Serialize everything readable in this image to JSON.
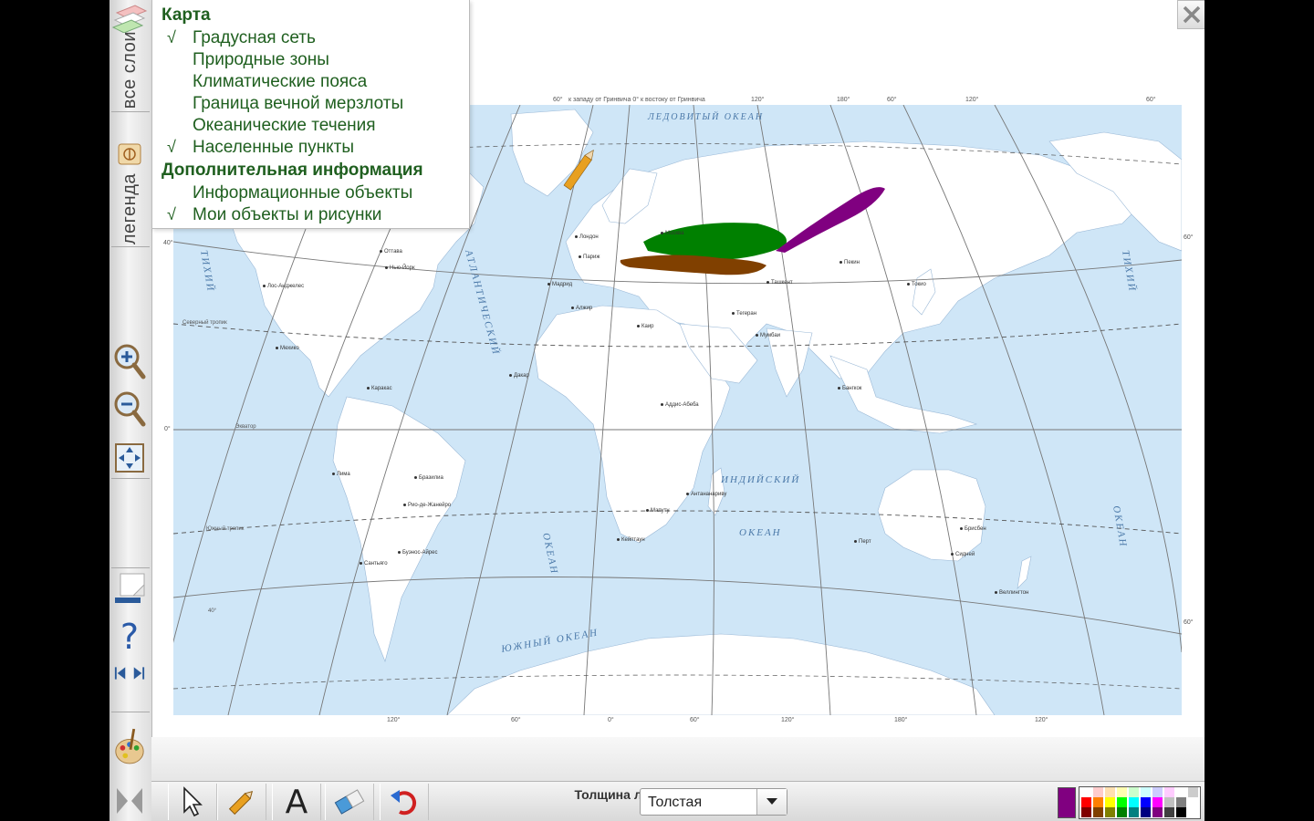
{
  "sidebar": {
    "layers_tab": "все слои",
    "legend_tab": "легенда"
  },
  "layers_panel": {
    "map_title": "Карта",
    "items": [
      {
        "label": "Градусная сеть",
        "checked": true
      },
      {
        "label": "Природные зоны",
        "checked": false
      },
      {
        "label": "Климатические пояса",
        "checked": false
      },
      {
        "label": "Граница вечной мерзлоты",
        "checked": false
      },
      {
        "label": "Океанические течения",
        "checked": false
      },
      {
        "label": "Населенные пункты",
        "checked": true
      }
    ],
    "extra_title": "Дополнительная информация",
    "extra_items": [
      {
        "label": "Информационные объекты",
        "checked": false
      },
      {
        "label": "Мои объекты и рисунки",
        "checked": true
      }
    ],
    "check_mark": "√"
  },
  "map": {
    "oceans": {
      "arctic": "ЛЕДОВИТЫЙ ОКЕАН",
      "atlantic": "АТЛАНТИЧЕСКИЙ",
      "atlantic2": "ОКЕАН",
      "indian": "ИНДИЙСКИЙ",
      "indian2": "ОКЕАН",
      "pacific_left": "ТИХИЙ",
      "pacific_right": "ТИХИЙ",
      "pacific_right2": "ОКЕАН",
      "southern": "ЮЖНЫЙ ОКЕАН"
    },
    "top_coords": [
      "60°",
      "к западу от Гринвича 0° к востоку от Гринвича",
      "120°",
      "180°",
      "60°",
      "120°",
      "60°"
    ],
    "bottom_coords": [
      "120°",
      "60°",
      "0°",
      "60°",
      "120°",
      "180°",
      "120°"
    ],
    "side_coords": [
      "40°",
      "0°",
      "60°",
      "60°"
    ],
    "line_labels": [
      "Северный тропик",
      "Экватор",
      "Южный тропик",
      "40°"
    ],
    "cities": [
      "Оттава",
      "Нью-Йорк",
      "Лос-Анджелес",
      "Мехико",
      "Каракас",
      "Лима",
      "Бразилиа",
      "Рио-де-Жанейро",
      "Сантьяго",
      "Буэнос-Айрес",
      "Дакар",
      "Лондон",
      "Париж",
      "Мадрид",
      "Алжир",
      "Каир",
      "Аддис-Абеба",
      "Кейптаун",
      "Мапуту",
      "Антананариву",
      "Тегеран",
      "Ташкент",
      "Мумбаи",
      "Пекин",
      "Токио",
      "Бангкок",
      "Брисбен",
      "Сидней",
      "Перт",
      "Веллингтон",
      "Москва"
    ],
    "drawing_colors": [
      "#008000",
      "#804000",
      "#800080"
    ]
  },
  "toolbar": {
    "thickness_label": "Толщина линии",
    "thickness_value": "Толстая",
    "text_tool_glyph": "A",
    "help_glyph": "?",
    "current_color": "#800080",
    "palette": [
      [
        "#ffffff",
        "#ffcccc",
        "#ffe0b0",
        "#ffffb0",
        "#ccffcc",
        "#ccffff",
        "#ccccff",
        "#ffccff",
        "#ffffff",
        "#cccccc"
      ],
      [
        "#ff0000",
        "#ff8000",
        "#ffff00",
        "#00ff00",
        "#00ffff",
        "#0000ff",
        "#ff00ff",
        "#c0c0c0",
        "#808080",
        "#ffffff"
      ],
      [
        "#800000",
        "#804000",
        "#808000",
        "#008000",
        "#008080",
        "#000080",
        "#800080",
        "#404040",
        "#000000",
        "#ffffff"
      ]
    ]
  }
}
